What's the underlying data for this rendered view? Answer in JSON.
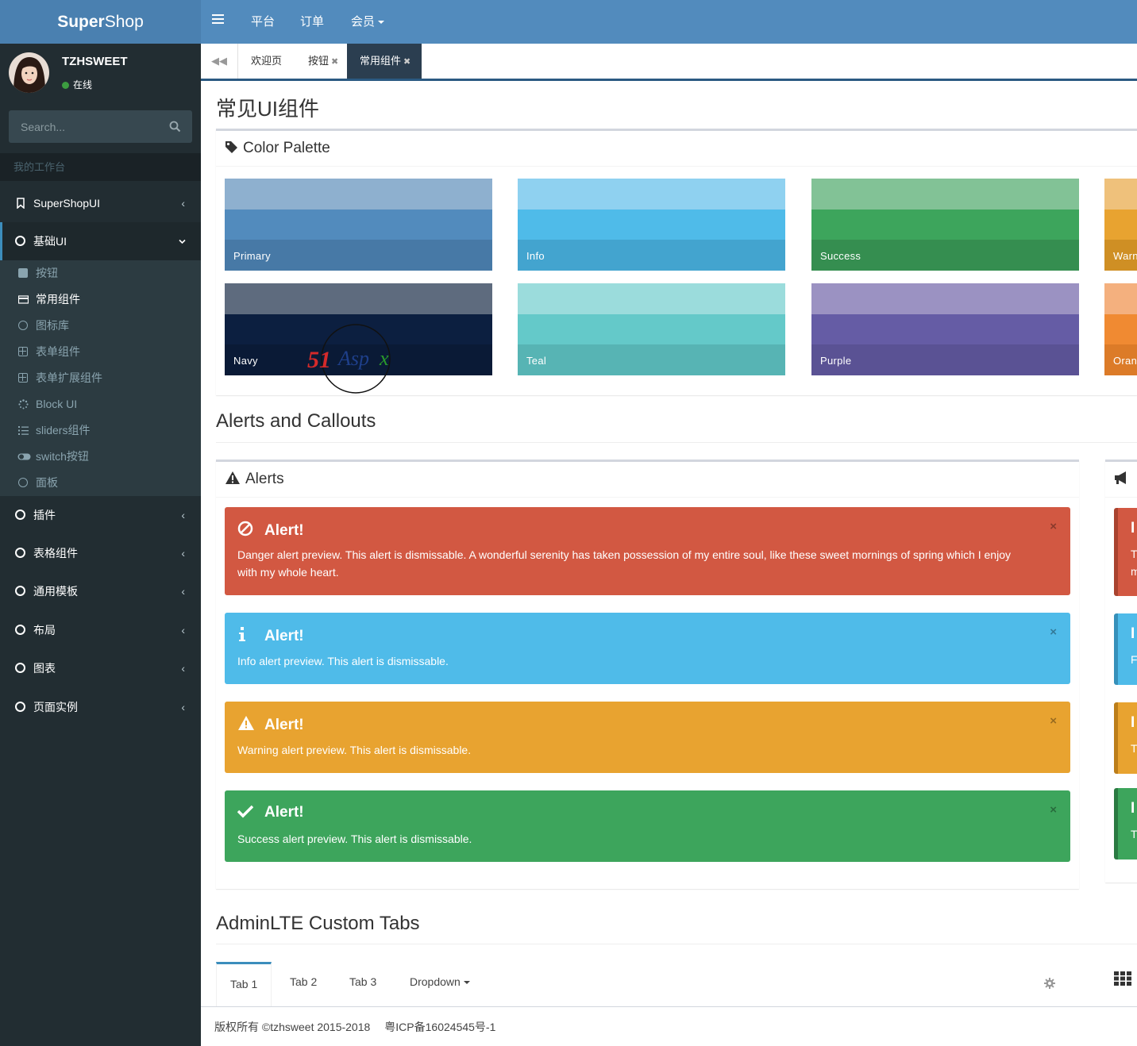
{
  "header": {
    "logo_bold": "Super",
    "logo_rest": "Shop",
    "nav": [
      "平台",
      "订单",
      "会员"
    ]
  },
  "user": {
    "name": "TZHSWEET",
    "status": "在线"
  },
  "search": {
    "placeholder": "Search..."
  },
  "sidebar": {
    "section_header": "我的工作台",
    "items": [
      {
        "label": "SuperShopUI",
        "icon": "bookmark-icon"
      },
      {
        "label": "基础UI",
        "icon": "circle-icon",
        "expanded": true
      },
      {
        "label": "插件",
        "icon": "circle-icon"
      },
      {
        "label": "表格组件",
        "icon": "circle-icon"
      },
      {
        "label": "通用模板",
        "icon": "circle-icon"
      },
      {
        "label": "布局",
        "icon": "circle-icon"
      },
      {
        "label": "图表",
        "icon": "circle-icon"
      },
      {
        "label": "页面实例",
        "icon": "circle-icon"
      }
    ],
    "subitems": [
      {
        "label": "按钮",
        "icon": "square-icon"
      },
      {
        "label": "常用组件",
        "icon": "credit-card-icon",
        "active": true
      },
      {
        "label": "图标库",
        "icon": "circle-icon"
      },
      {
        "label": "表单组件",
        "icon": "plus-square-icon"
      },
      {
        "label": "表单扩展组件",
        "icon": "plus-square-icon"
      },
      {
        "label": "Block UI",
        "icon": "spinner-icon"
      },
      {
        "label": "sliders组件",
        "icon": "list-icon"
      },
      {
        "label": "switch按钮",
        "icon": "toggle-icon"
      },
      {
        "label": "面板",
        "icon": "circle-icon"
      }
    ]
  },
  "page_tabs": [
    {
      "label": "欢迎页",
      "closable": false
    },
    {
      "label": "按钮",
      "closable": true
    },
    {
      "label": "常用组件",
      "closable": true,
      "active": true
    }
  ],
  "page_title": "常见UI组件",
  "palette": {
    "title": "Color Palette",
    "swatches": [
      {
        "label": "Primary",
        "colors": [
          "#8eb0cf",
          "#528bbd",
          "#4779a6"
        ]
      },
      {
        "label": "Info",
        "colors": [
          "#8fd1f0",
          "#4fbbe9",
          "#43a4cf"
        ]
      },
      {
        "label": "Success",
        "colors": [
          "#82c296",
          "#3da55c",
          "#358e50"
        ]
      },
      {
        "label": "Warn",
        "colors": [
          "#efc17b",
          "#e8a330",
          "#cf8f24"
        ]
      },
      {
        "label": "Navy",
        "colors": [
          "#5e6b7e",
          "#0c1f40",
          "#0a1a36"
        ]
      },
      {
        "label": "Teal",
        "colors": [
          "#9bdcdc",
          "#64c9c9",
          "#57b4b4"
        ]
      },
      {
        "label": "Purple",
        "colors": [
          "#9b92c2",
          "#655ca5",
          "#5a5294"
        ]
      },
      {
        "label": "Oran",
        "colors": [
          "#f4b07e",
          "#f08a32",
          "#dc7b28"
        ]
      }
    ],
    "watermark": "51Aspx"
  },
  "alerts_section": {
    "title": "Alerts and Callouts",
    "alerts_box_title": "Alerts",
    "alerts": [
      {
        "type": "danger",
        "title": "Alert!",
        "icon": "ban-icon",
        "color": "#d25842",
        "body": "Danger alert preview. This alert is dismissable. A wonderful serenity has taken possession of my entire soul, like these sweet mornings of spring which I enjoy with my whole heart."
      },
      {
        "type": "info",
        "title": "Alert!",
        "icon": "info-icon",
        "color": "#4fbbe9",
        "body": "Info alert preview. This alert is dismissable."
      },
      {
        "type": "warning",
        "title": "Alert!",
        "icon": "warning-icon",
        "color": "#e8a330",
        "body": "Warning alert preview. This alert is dismissable."
      },
      {
        "type": "success",
        "title": "Alert!",
        "icon": "check-icon",
        "color": "#3da55c",
        "body": "Success alert preview. This alert is dismissable."
      }
    ],
    "callouts": [
      {
        "color": "#d25842",
        "border": "#a9432f",
        "letter": "I",
        "small": [
          "T",
          "m"
        ]
      },
      {
        "color": "#4fbbe9",
        "border": "#3690ba",
        "letter": "I",
        "small": [
          "F"
        ]
      },
      {
        "color": "#e8a330",
        "border": "#bc7e1a",
        "letter": "I",
        "small": [
          "T"
        ]
      },
      {
        "color": "#3da55c",
        "border": "#2a7a42",
        "letter": "I",
        "small": [
          "T"
        ]
      }
    ]
  },
  "custom_tabs": {
    "title": "AdminLTE Custom Tabs",
    "tabs": [
      "Tab 1",
      "Tab 2",
      "Tab 3",
      "Dropdown"
    ]
  },
  "footer": {
    "copyright": "版权所有 ©tzhsweet 2015-2018",
    "icp": "粤ICP备16024545号-1"
  }
}
